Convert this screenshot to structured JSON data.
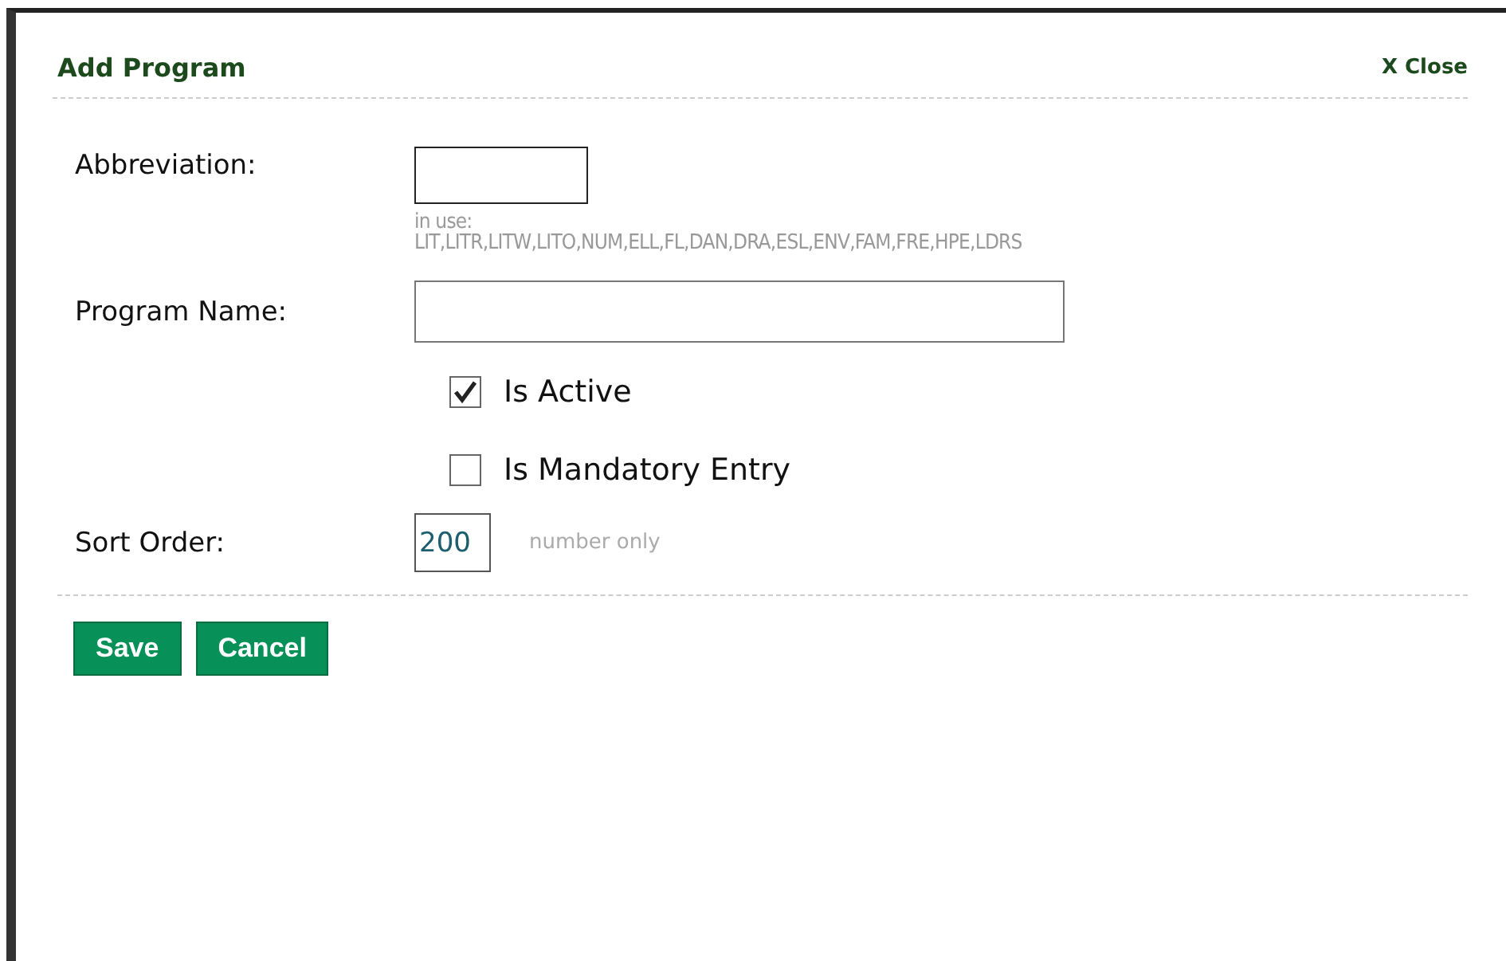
{
  "dialog": {
    "title": "Add Program",
    "close": "X Close"
  },
  "abbreviation": {
    "label": "Abbreviation:",
    "in_use_label": "in use:",
    "in_use": "LIT,LITR,LITW,LITO,NUM,ELL,FL,DAN,DRA,ESL,ENV,FAM,FRE,HPE,LDRS"
  },
  "program_name": {
    "label": "Program Name:"
  },
  "options": [
    {
      "label": "Is Active",
      "checked": true
    },
    {
      "label": "Is Mandatory Entry",
      "checked": false
    }
  ],
  "sort_order": {
    "label": "Sort Order:",
    "value": "200",
    "hint": "number only"
  },
  "buttons": [
    "Save",
    "Cancel"
  ]
}
